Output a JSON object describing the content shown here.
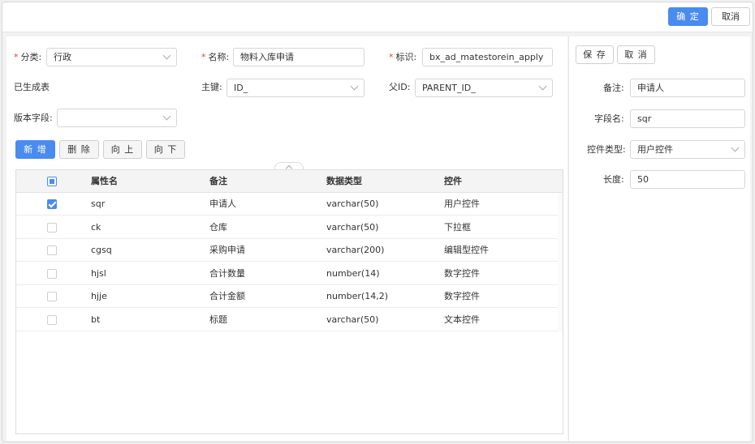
{
  "topbar": {
    "confirm_label": "确 定",
    "cancel_label": "取消"
  },
  "form": {
    "category": {
      "label": "分类:",
      "value": "行政"
    },
    "name": {
      "label": "名称:",
      "value": "物料入库申请"
    },
    "identifier": {
      "label": "标识:",
      "value": "bx_ad_matestorein_apply"
    },
    "generated_text": "已生成表",
    "primary_key": {
      "label": "主键:",
      "value": "ID_"
    },
    "parent_id": {
      "label": "父ID:",
      "value": "PARENT_ID_"
    },
    "version_field": {
      "label": "版本字段:",
      "value": ""
    }
  },
  "toolbar": {
    "add_label": "新 增",
    "delete_label": "删 除",
    "up_label": "向 上",
    "down_label": "向 下"
  },
  "table": {
    "columns": [
      "属性名",
      "备注",
      "数据类型",
      "控件"
    ],
    "rows": [
      {
        "name": "sqr",
        "remark": "申请人",
        "type": "varchar(50)",
        "control": "用户控件",
        "checked": true
      },
      {
        "name": "ck",
        "remark": "仓库",
        "type": "varchar(50)",
        "control": "下拉框",
        "checked": false
      },
      {
        "name": "cgsq",
        "remark": "采购申请",
        "type": "varchar(200)",
        "control": "编辑型控件",
        "checked": false
      },
      {
        "name": "hjsl",
        "remark": "合计数量",
        "type": "number(14)",
        "control": "数字控件",
        "checked": false
      },
      {
        "name": "hjje",
        "remark": "合计金额",
        "type": "number(14,2)",
        "control": "数字控件",
        "checked": false
      },
      {
        "name": "bt",
        "remark": "标题",
        "type": "varchar(50)",
        "control": "文本控件",
        "checked": false
      }
    ]
  },
  "detail": {
    "save_label": "保 存",
    "cancel_label": "取 消",
    "remark": {
      "label": "备注:",
      "value": "申请人"
    },
    "field_name": {
      "label": "字段名:",
      "value": "sqr"
    },
    "control_type": {
      "label": "控件类型:",
      "value": "用户控件"
    },
    "length": {
      "label": "长度:",
      "value": "50"
    }
  },
  "colors": {
    "primary": "#4a8bf0",
    "required": "#e23c3c"
  }
}
